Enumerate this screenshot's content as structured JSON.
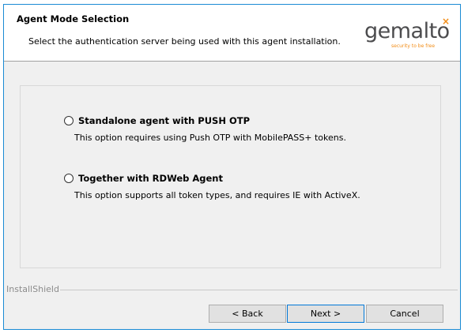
{
  "header": {
    "title": "Agent Mode Selection",
    "subtitle": "Select the authentication server being used with this agent installation.",
    "logo": {
      "word": "gemalto",
      "mark": "×",
      "tagline": "security to be free",
      "word_color": "#4c4c4e",
      "accent_color": "#f28c16"
    }
  },
  "options": [
    {
      "label": "Standalone agent with PUSH OTP",
      "description": "This option requires using Push OTP with MobilePASS+ tokens.",
      "selected": false
    },
    {
      "label": "Together with RDWeb Agent",
      "description": "This option supports all token types, and requires IE with ActiveX.",
      "selected": false
    }
  ],
  "footer": {
    "brand": "InstallShield",
    "buttons": {
      "back": "< Back",
      "next": "Next >",
      "cancel": "Cancel"
    }
  },
  "colors": {
    "window_border": "#1a8ad4",
    "dialog_background": "#f0f0f0",
    "header_background": "#ffffff"
  }
}
